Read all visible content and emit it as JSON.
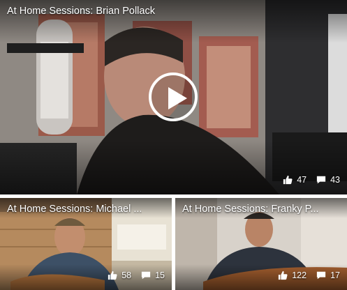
{
  "videos": [
    {
      "title": "At Home Sessions: Brian Pollack",
      "likes": "47",
      "comments": "43"
    },
    {
      "title": "At Home Sessions: Michael ...",
      "likes": "58",
      "comments": "15"
    },
    {
      "title": "At Home Sessions: Franky P...",
      "likes": "122",
      "comments": "17"
    }
  ],
  "icons": {
    "play": "play-icon",
    "like": "thumbs-up-icon",
    "comment": "speech-bubble-icon"
  }
}
